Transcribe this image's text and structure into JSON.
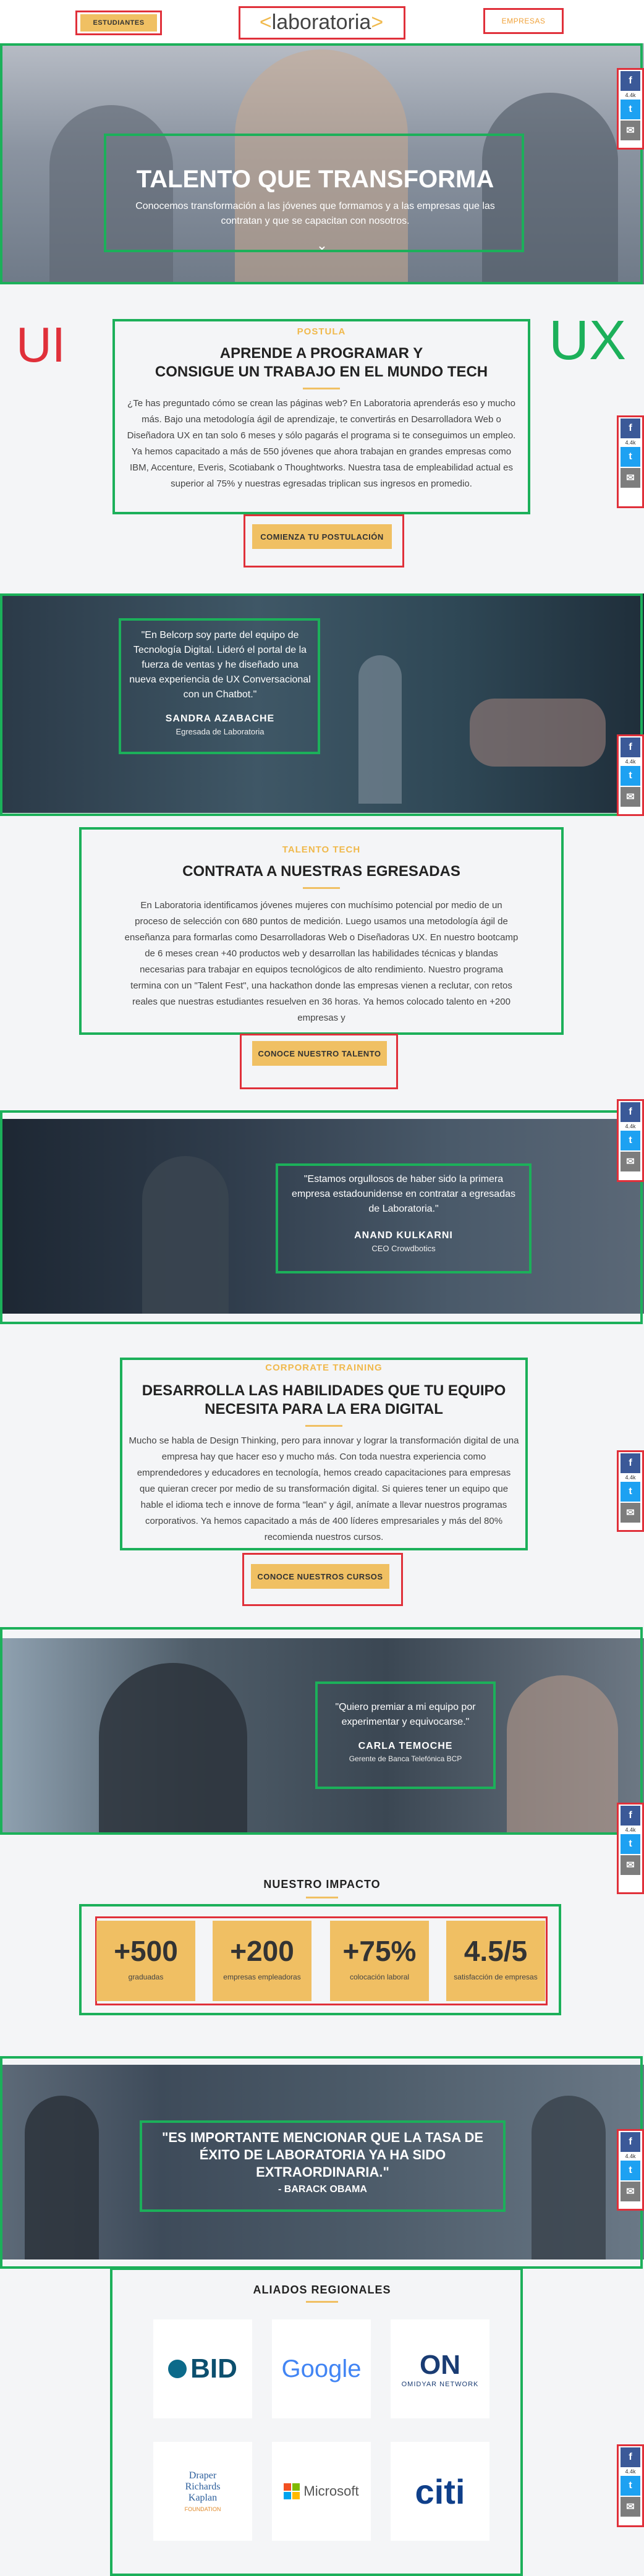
{
  "header": {
    "students_label": "ESTUDIANTES",
    "logo_text": "laboratoria",
    "companies_label": "EMPRESAS"
  },
  "hero": {
    "title": "TALENTO QUE TRANSFORMA",
    "subtitle": "Conocemos transformación a las jóvenes que formamos y a las empresas que las contratan y que se capacitan con nosotros."
  },
  "share": {
    "count": "4.4k"
  },
  "postula": {
    "side_left": "UI",
    "side_right": "UX",
    "eyebrow": "POSTULA",
    "title_line1": "APRENDE A PROGRAMAR Y",
    "title_line2": "CONSIGUE UN TRABAJO EN EL MUNDO TECH",
    "body": "¿Te has preguntado cómo se crean las páginas web? En Laboratoria aprenderás eso y mucho más. Bajo una metodología ágil de aprendizaje, te convertirás en Desarrolladora Web o Diseñadora UX en tan solo 6 meses y sólo pagarás el programa si te conseguimos un empleo. Ya hemos capacitado a más de 550 jóvenes que ahora trabajan en grandes empresas como IBM, Accenture, Everis, Scotiabank o Thoughtworks. Nuestra tasa de empleabilidad actual es superior al 75% y nuestras egresadas triplican sus ingresos en promedio.",
    "cta": "COMIENZA TU POSTULACIÓN"
  },
  "testimonial1": {
    "quote": "\"En Belcorp soy parte del equipo de Tecnología Digital. Lideró el portal de la fuerza de ventas y he diseñado una nueva experiencia de UX Conversacional con un Chatbot.\"",
    "name": "SANDRA AZABACHE",
    "role": "Egresada de Laboratoria"
  },
  "talent": {
    "eyebrow": "TALENTO TECH",
    "title": "CONTRATA A NUESTRAS EGRESADAS",
    "body": "En Laboratoria identificamos jóvenes mujeres con muchísimo potencial por medio de un proceso de selección con 680 puntos de medición. Luego usamos una metodología ágil de enseñanza para formarlas como Desarrolladoras Web o Diseñadoras UX. En nuestro bootcamp de 6 meses crean +40 productos web y desarrollan las habilidades técnicas y blandas necesarias para trabajar en equipos tecnológicos de alto rendimiento. Nuestro programa termina con un \"Talent Fest\", una hackathon donde las empresas vienen a reclutar, con retos reales que nuestras estudiantes resuelven en 36 horas. Ya hemos colocado talento en +200 empresas y",
    "cta": "CONOCE NUESTRO TALENTO"
  },
  "testimonial2": {
    "quote": "\"Estamos orgullosos de haber sido la primera empresa estadounidense en contratar a egresadas de Laboratoria.\"",
    "name": "ANAND KULKARNI",
    "role": "CEO Crowdbotics"
  },
  "corporate": {
    "eyebrow": "CORPORATE TRAINING",
    "title_line1": "DESARROLLA LAS HABILIDADES QUE TU EQUIPO",
    "title_line2": "NECESITA PARA LA ERA DIGITAL",
    "body": "Mucho se habla de Design Thinking, pero para innovar y lograr la transformación digital de una empresa hay que hacer eso y mucho más. Con toda nuestra experiencia como emprendedores y educadores en tecnología, hemos creado capacitaciones para empresas que quieran crecer por medio de su transformación digital. Si quieres tener un equipo que hable el idioma tech e innove de forma \"lean\" y ágil, anímate a llevar nuestros programas corporativos. Ya hemos capacitado a más de 400 líderes empresariales y más del 80% recomienda nuestros cursos.",
    "cta": "CONOCE NUESTROS CURSOS"
  },
  "testimonial3": {
    "quote": "\"Quiero premiar a mi equipo por experimentar y equivocarse.\"",
    "name": "CARLA TEMOCHE",
    "role": "Gerente de Banca Telefónica BCP"
  },
  "impact": {
    "title": "NUESTRO IMPACTO",
    "stats": [
      {
        "value": "+500",
        "label": "graduadas"
      },
      {
        "value": "+200",
        "label": "empresas empleadoras"
      },
      {
        "value": "+75%",
        "label": "colocación laboral"
      },
      {
        "value": "4.5/5",
        "label": "satisfacción de empresas"
      }
    ]
  },
  "obama": {
    "quote_line1": "\"ES IMPORTANTE MENCIONAR QUE LA TASA DE",
    "quote_line2": "ÉXITO DE LABORATORIA YA HA SIDO",
    "quote_line3": "EXTRAORDINARIA.\"",
    "author": "- BARACK OBAMA"
  },
  "allies": {
    "title": "ALIADOS REGIONALES",
    "logos": [
      {
        "name": "BID"
      },
      {
        "name": "Google"
      },
      {
        "name": "ON",
        "sub": "OMIDYAR NETWORK"
      },
      {
        "name": "Draper Richards Kaplan",
        "sub": "FOUNDATION"
      },
      {
        "name": "Microsoft"
      },
      {
        "name": "citi"
      }
    ]
  },
  "colors": {
    "accent_yellow": "#f0c063",
    "annotation_green": "#1cb05a",
    "annotation_red": "#e0303a",
    "facebook": "#3b5998",
    "twitter": "#1da1f2"
  }
}
